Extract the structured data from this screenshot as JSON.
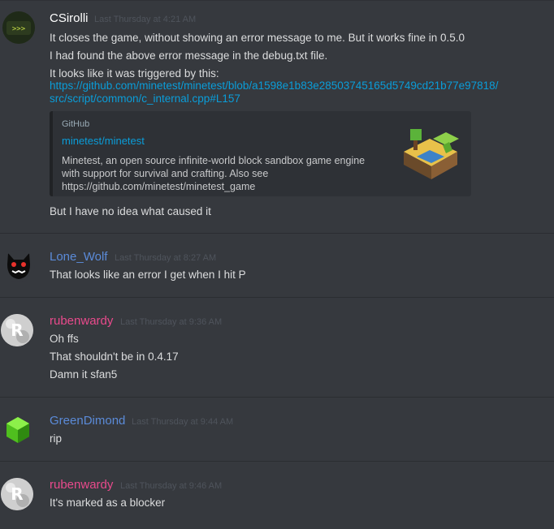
{
  "messages": [
    {
      "username": "CSirolli",
      "username_color": "#ffffff",
      "timestamp": "Last Thursday at 4:21 AM",
      "lines": [
        "It closes the game, without showing an error message to me. But it works fine in 0.5.0",
        "I had found the above error message in the debug.txt file.",
        "It looks like it was triggered by this:"
      ],
      "link_line1": "https://github.com/minetest/minetest/blob/a1598e1b83e28503745165d5749cd21b77e97818/",
      "link_line2": "src/script/common/c_internal.cpp#L157",
      "embed": {
        "provider": "GitHub",
        "title": "minetest/minetest",
        "description_lines": [
          "Minetest, an open source infinite-world block sandbox game engine",
          "with support for survival and crafting. Also see",
          "https://github.com/minetest/minetest_game"
        ]
      },
      "after_embed": "But I have no idea what caused it"
    },
    {
      "username": "Lone_Wolf",
      "username_color": "#5b8bd9",
      "timestamp": "Last Thursday at 8:27 AM",
      "lines": [
        "That looks like an error I get when I hit P"
      ]
    },
    {
      "username": "rubenwardy",
      "username_color": "#e94a8c",
      "timestamp": "Last Thursday at 9:36 AM",
      "lines": [
        "Oh ffs",
        "That shouldn't be in 0.4.17",
        "Damn it sfan5"
      ]
    },
    {
      "username": "GreenDimond",
      "username_color": "#5b8bd9",
      "timestamp": "Last Thursday at 9:44 AM",
      "lines": [
        "rip"
      ]
    },
    {
      "username": "rubenwardy",
      "username_color": "#e94a8c",
      "timestamp": "Last Thursday at 9:46 AM",
      "lines": [
        "It's marked as a blocker"
      ]
    }
  ]
}
